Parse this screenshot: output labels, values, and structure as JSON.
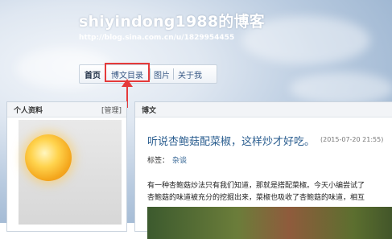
{
  "header": {
    "blog_title": "shiyindong1988的博客",
    "blog_url": "http://blog.sina.com.cn/u/1829954455"
  },
  "nav": {
    "items": [
      {
        "label": "首页",
        "active": true
      },
      {
        "label": "博文目录",
        "active": false
      },
      {
        "label": "图片",
        "active": false
      },
      {
        "label": "关于我",
        "active": false
      }
    ]
  },
  "profile_panel": {
    "title": "个人资料",
    "manage_label": "[管理]"
  },
  "posts_panel": {
    "title": "博文",
    "post": {
      "title": "听说杏鲍菇配菜椒，这样炒才好吃。",
      "time": "(2015-07-20 21:55)",
      "tags_label": "标签：",
      "tag": "杂谈",
      "body_lines": [
        "有一种杏鲍菇炒法只有我们知道，那就是搭配菜椒。今天小编尝试了",
        "杏鲍菇的味道被充分的挖掘出来，菜椒也吸收了杏鲍菇的味道，相互"
      ]
    }
  },
  "annotation": {
    "highlight_color": "#e53a3a"
  }
}
